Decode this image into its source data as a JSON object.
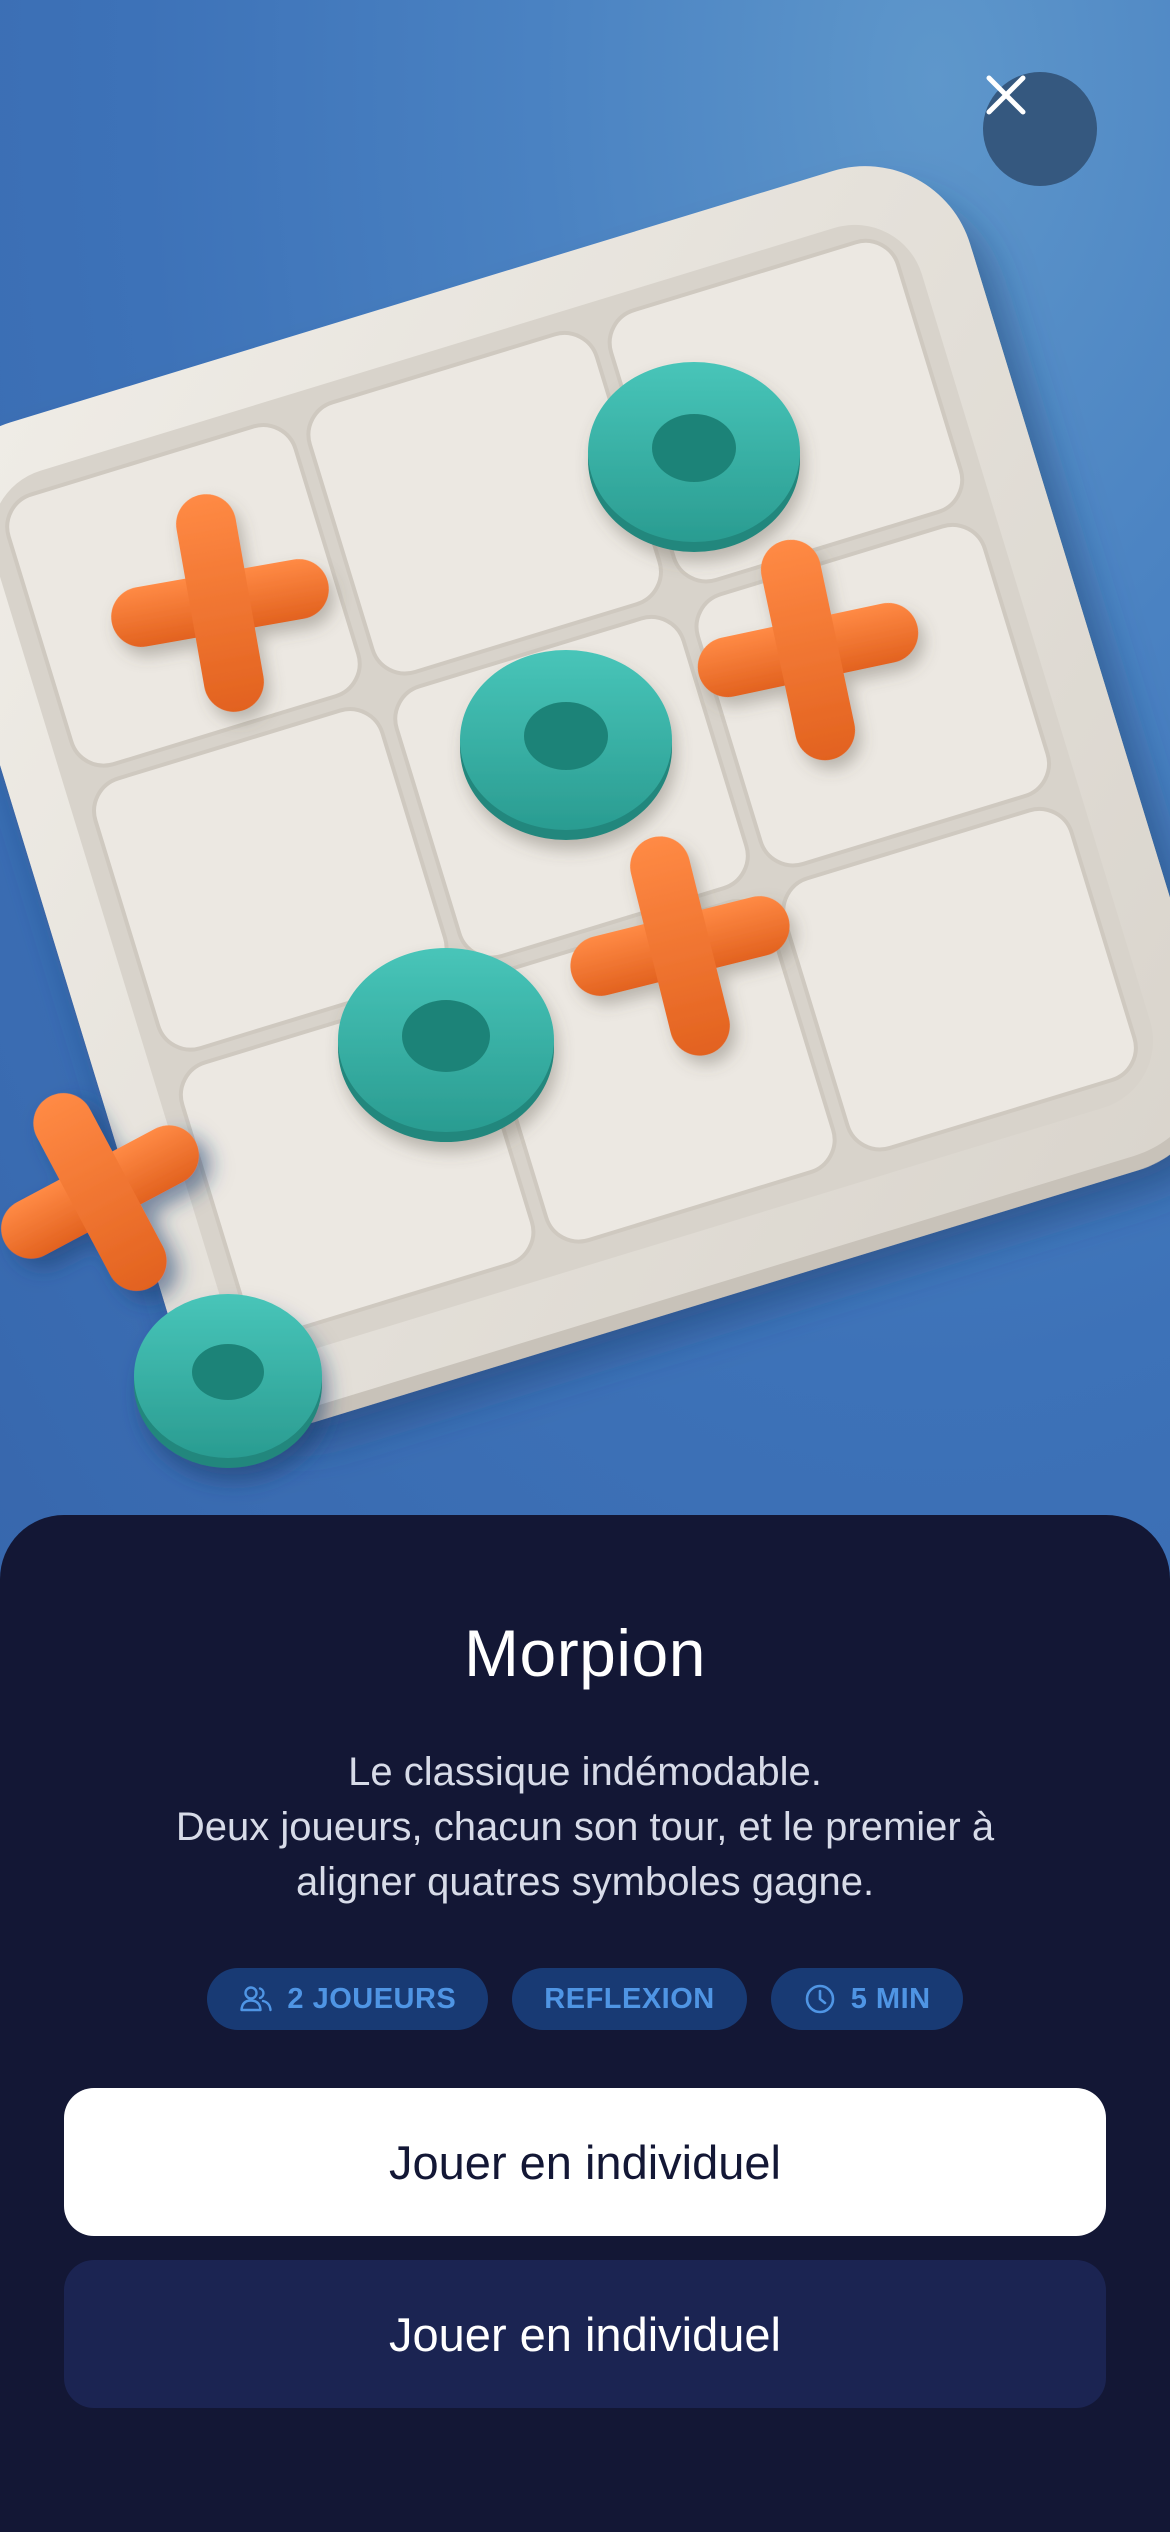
{
  "game": {
    "title": "Morpion",
    "description_lines": [
      "Le classique indémodable.",
      "Deux joueurs, chacun son tour, et le premier à",
      "aligner quatres symboles gagne."
    ],
    "tags": [
      {
        "icon": "users-icon",
        "label": "2 JOUEURS"
      },
      {
        "icon": "",
        "label": "REFLEXION"
      },
      {
        "icon": "clock-icon",
        "label": "5 MIN"
      }
    ]
  },
  "buttons": {
    "primary_label": "Jouer en individuel",
    "secondary_label": "Jouer en individuel"
  },
  "icons": {
    "close": "close-icon"
  },
  "colors": {
    "hero_background": "#4a82c2",
    "sheet_background": "#131735",
    "tag_background": "#183a74",
    "tag_text": "#4f95e4",
    "primary_button": "#ffffff",
    "secondary_button": "#1b2452",
    "x_piece": "#f47432",
    "o_piece": "#37b3a8",
    "board": "#e8e4dd"
  }
}
